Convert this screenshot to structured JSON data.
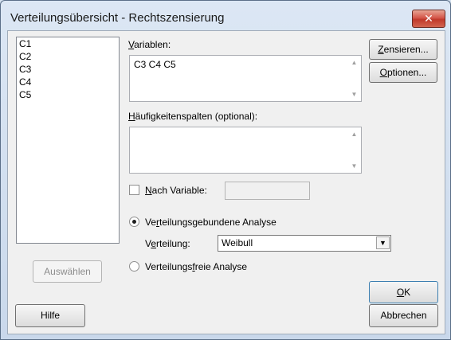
{
  "window": {
    "title": "Verteilungsübersicht - Rechtszensierung",
    "close_glyph": "✕"
  },
  "columns": [
    "C1",
    "C2",
    "C3",
    "C4",
    "C5"
  ],
  "variables": {
    "label_pre": "",
    "label_u": "V",
    "label_post": "ariablen:",
    "value": "C3 C4 C5"
  },
  "frequency": {
    "label_pre": "",
    "label_u": "H",
    "label_post": "äufigkeitenspalten (optional):",
    "value": ""
  },
  "by_variable": {
    "label_pre": "",
    "label_u": "N",
    "label_post": "ach Variable:",
    "checked": false,
    "value": ""
  },
  "parametric": {
    "label_pre": "Ve",
    "label_u": "r",
    "label_post": "teilungsgebundene Analyse",
    "selected": true
  },
  "distribution": {
    "label_pre": "V",
    "label_u": "e",
    "label_post": "rteilung:",
    "value": "Weibull"
  },
  "nonparametric": {
    "label_pre": "Verteilungs",
    "label_u": "f",
    "label_post": "reie Analyse",
    "selected": false
  },
  "buttons": {
    "censor_pre": "",
    "censor_u": "Z",
    "censor_post": "ensieren...",
    "options_pre": "",
    "options_u": "O",
    "options_post": "ptionen...",
    "select": "Auswählen",
    "help": "Hilfe",
    "ok_pre": "",
    "ok_u": "O",
    "ok_post": "K",
    "cancel": "Abbrechen"
  },
  "icons": {
    "scroll_up": "▲",
    "scroll_down": "▼",
    "dropdown": "▼"
  }
}
